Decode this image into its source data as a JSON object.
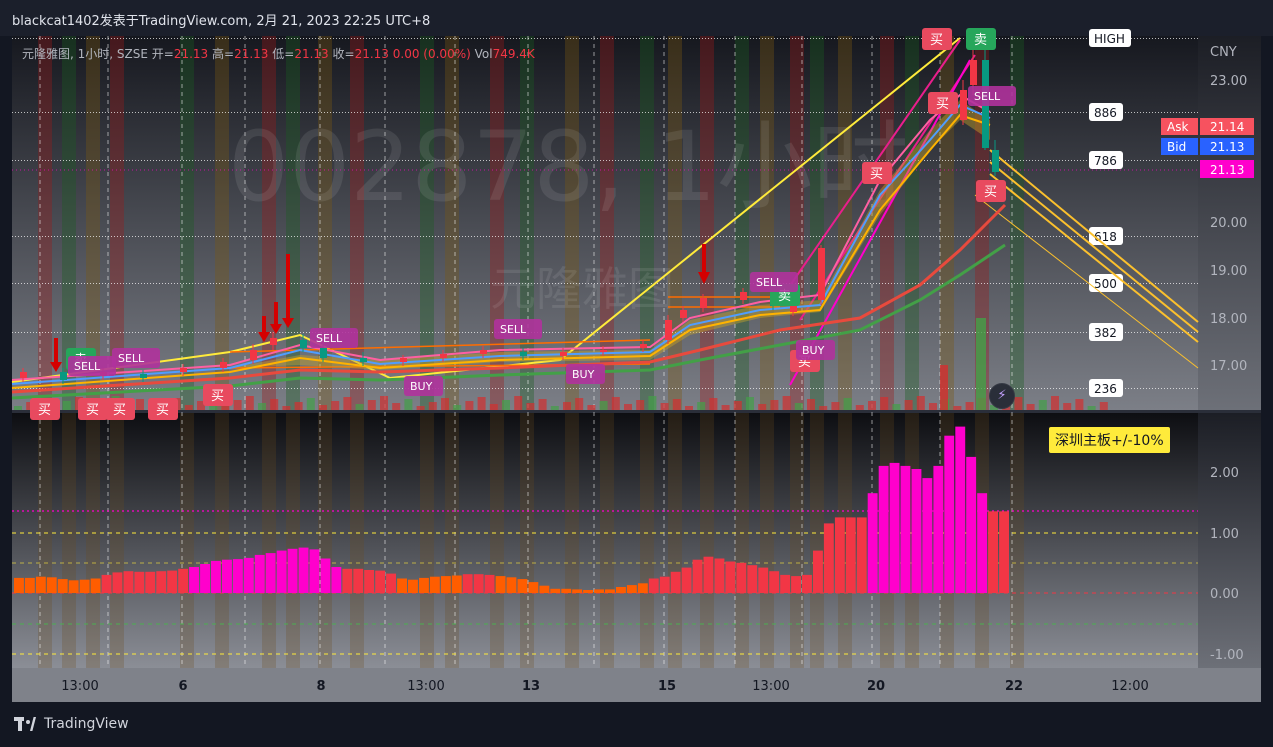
{
  "header": {
    "title": "blackcat1402发表于TradingView.com,  2月 21, 2023 22:25 UTC+8"
  },
  "legend": {
    "name": "元隆雅图, 1小时, SZSE",
    "open_label": "开=",
    "open": "21.13",
    "high_label": "高=",
    "high": "21.13",
    "low_label": "低=",
    "low": "21.13",
    "close_label": "收=",
    "close": "21.13",
    "change": "0.00 (0.00%)",
    "vol_label": "Vol",
    "vol": "749.4K"
  },
  "watermark": {
    "symbol": "002878, 1小时",
    "name": "元隆雅图"
  },
  "price_axis": {
    "currency": "CNY",
    "ticks": [
      "23.00",
      "20.00",
      "19.00",
      "18.00",
      "17.00"
    ],
    "ask_label": "Ask",
    "ask": "21.14",
    "bid_label": "Bid",
    "bid": "21.13",
    "last": "21.13",
    "fib_labels": [
      "HIGH",
      "886",
      "786",
      "618",
      "500",
      "382",
      "236"
    ]
  },
  "time_axis": {
    "labels": [
      "13:00",
      "6",
      "8",
      "13:00",
      "13",
      "15",
      "13:00",
      "20",
      "22",
      "12:00"
    ]
  },
  "signals": {
    "buy": "买",
    "sell": "卖",
    "buy_en": "BUY",
    "sell_en": "SELL"
  },
  "sub_pane": {
    "label": "深圳主板+/-10%",
    "ticks": [
      "2.00",
      "1.00",
      "0.00",
      "-1.00"
    ]
  },
  "footer": {
    "brand": "TradingView"
  },
  "colors": {
    "candle_up": "#f23645",
    "candle_down": "#089981",
    "fib_line": "#ffffff",
    "trend_line": "#ffeb3b",
    "channel": "#fbc02d",
    "ask": "#f7525f",
    "bid": "#2962ff",
    "last": "#ff00cc",
    "hist_high": "#ff00cc",
    "hist_mid": "#f23645",
    "hist_low": "#ff5d00",
    "label_bg": "#ffeb3b"
  },
  "chart_data": {
    "type": "bar",
    "title": "深圳主板+/-10%",
    "xlabel": "",
    "ylabel": "",
    "ylim": [
      -1.2,
      2.7
    ],
    "categories": [
      "13:00",
      "6",
      "8",
      "13:00",
      "13",
      "15",
      "13:00",
      "20",
      "22",
      "12:00"
    ],
    "values": [
      0.25,
      0.25,
      0.27,
      0.26,
      0.23,
      0.21,
      0.22,
      0.24,
      0.3,
      0.34,
      0.36,
      0.35,
      0.35,
      0.36,
      0.37,
      0.4,
      0.43,
      0.48,
      0.53,
      0.55,
      0.56,
      0.58,
      0.63,
      0.66,
      0.7,
      0.73,
      0.75,
      0.72,
      0.57,
      0.43,
      0.4,
      0.4,
      0.38,
      0.37,
      0.32,
      0.24,
      0.22,
      0.25,
      0.27,
      0.28,
      0.29,
      0.31,
      0.31,
      0.3,
      0.28,
      0.26,
      0.23,
      0.18,
      0.12,
      0.07,
      0.07,
      0.06,
      0.05,
      0.06,
      0.06,
      0.1,
      0.13,
      0.16,
      0.24,
      0.27,
      0.35,
      0.42,
      0.55,
      0.6,
      0.57,
      0.52,
      0.5,
      0.46,
      0.42,
      0.36,
      0.3,
      0.28,
      0.3,
      0.7,
      1.15,
      1.25,
      1.25,
      1.25,
      1.65,
      2.1,
      2.15,
      2.1,
      2.05,
      1.9,
      2.1,
      2.6,
      2.75,
      2.25,
      1.65,
      1.35,
      1.35
    ],
    "colors_by_level": {
      "high": "#ff00cc",
      "mid": "#f23645",
      "low": "#ff5d00"
    }
  }
}
